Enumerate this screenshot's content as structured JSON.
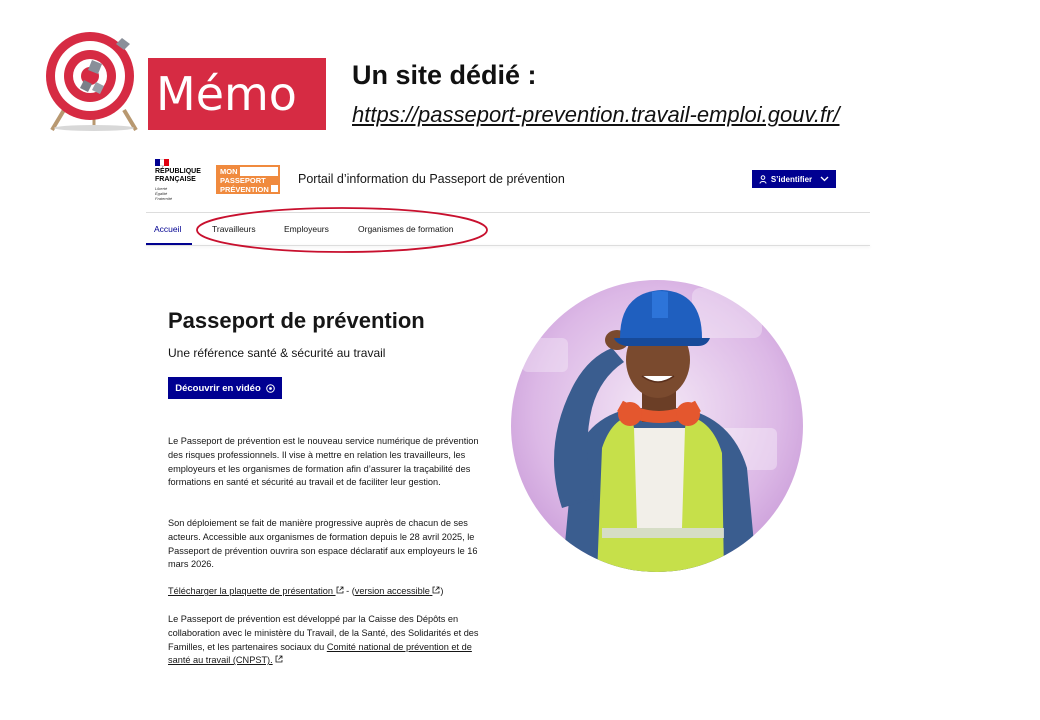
{
  "memo": {
    "banner_label": "Mémo",
    "title": "Un site dédié :",
    "url": "https://passeport-prevention.travail-emploi.gouv.fr/"
  },
  "site": {
    "republic_logo": {
      "name_line1": "RÉPUBLIQUE",
      "name_line2": "FRANÇAISE",
      "motto1": "Liberté",
      "motto2": "Égalité",
      "motto3": "Fraternité",
      "flag_colors": [
        "#000091",
        "#ffffff",
        "#e1000f"
      ]
    },
    "mon_passeport_logo": {
      "line1": "MON",
      "line2": "PASSEPORT",
      "line3": "PRÉVENTION",
      "color": "#f08a3e"
    },
    "portal_title": "Portail d’information du Passeport de prévention",
    "login_button": {
      "label": "S’identifier",
      "icon": "user-icon",
      "chevron": "chevron-down-icon"
    },
    "nav": {
      "items": [
        {
          "label": "Accueil",
          "active": true
        },
        {
          "label": "Travailleurs",
          "active": false
        },
        {
          "label": "Employeurs",
          "active": false
        },
        {
          "label": "Organismes de formation",
          "active": false
        }
      ],
      "highlight_color": "#c8102e"
    },
    "hero": {
      "title": "Passeport de prévention",
      "subtitle": "Une référence santé & sécurité au travail",
      "video_button": "Découvrir en vidéo",
      "video_icon": "play-circle-icon",
      "image": "worker-with-hardhat-photo"
    },
    "paragraphs": {
      "p1": "Le Passeport de prévention est le nouveau service numérique de prévention des risques professionnels. Il vise à mettre en relation les travailleurs, les employeurs et les organismes de formation afin d’assurer la traçabilité des formations en santé et sécurité au travail et de faciliter leur gestion.",
      "p2": "Son déploiement se fait de manière progressive auprès de chacun de ses acteurs. Accessible aux organismes de formation depuis le 28 avril 2025, le Passeport de prévention ouvrira son espace déclaratif aux employeurs le 16 mars 2026.",
      "download_link": "Télécharger la plaquette de présentation",
      "separator": " - (",
      "accessible_link": "version accessible",
      "close_paren": ")",
      "p4_text": "Le Passeport de prévention est développé par la Caisse des Dépôts en collaboration avec le ministère du Travail, de la Santé, des Solidarités et des Familles, et les partenaires sociaux du ",
      "cnpst_link": "Comité national de prévention et de santé au travail (CNPST)."
    },
    "accent_color": "#000091"
  }
}
